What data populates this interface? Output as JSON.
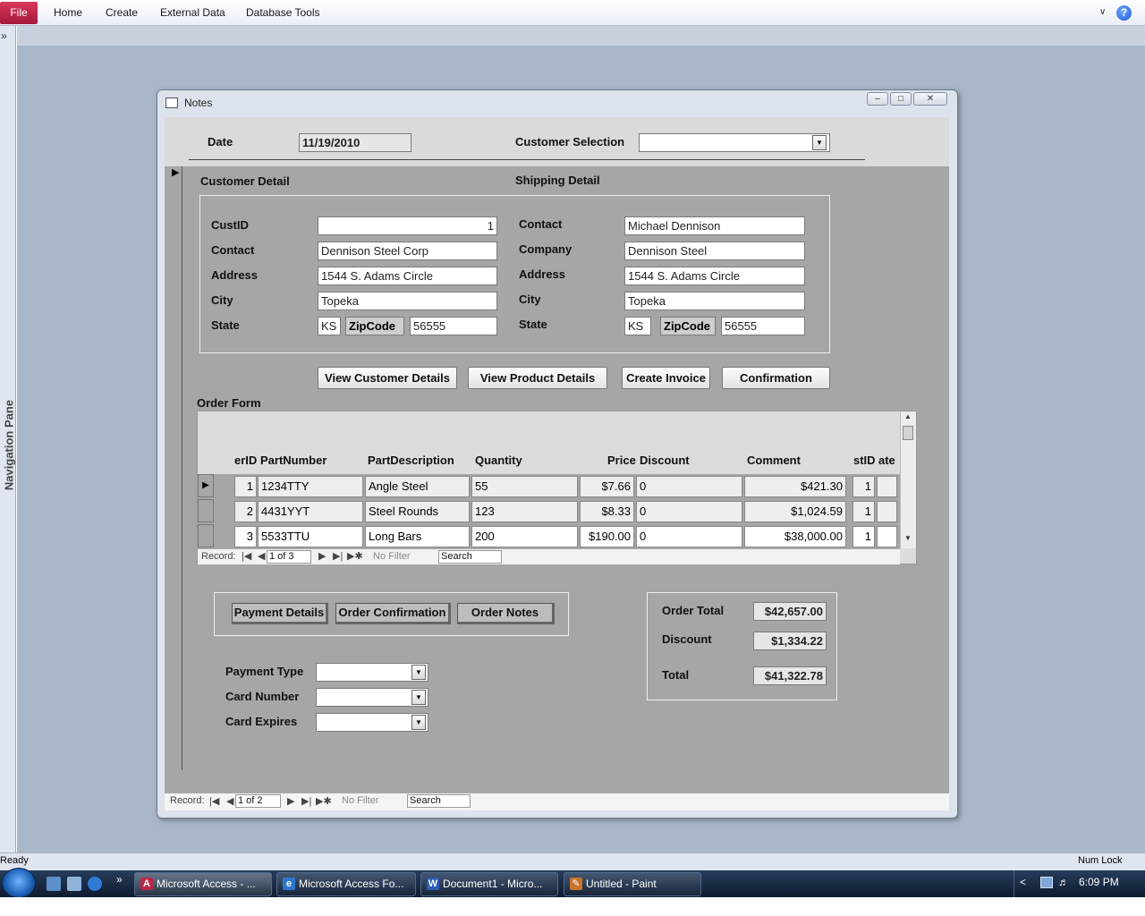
{
  "ribbon": {
    "file": "File",
    "tabs": [
      "Home",
      "Create",
      "External Data",
      "Database Tools"
    ],
    "minimize": "∨",
    "help": "?"
  },
  "nav_pane": {
    "toggle": "»",
    "label": "Navigation Pane"
  },
  "window": {
    "title": "Notes",
    "min": "–",
    "max": "□",
    "close": "✕"
  },
  "header": {
    "date_label": "Date",
    "date_value": "11/19/2010",
    "customer_selection_label": "Customer Selection",
    "customer_selection_value": ""
  },
  "customer": {
    "title": "Customer Detail",
    "custid_label": "CustID",
    "custid": "1",
    "contact_label": "Contact",
    "contact": "Dennison Steel Corp",
    "address_label": "Address",
    "address": "1544 S. Adams Circle",
    "city_label": "City",
    "city": "Topeka",
    "state_label": "State",
    "state": "KS",
    "zip_label": "ZipCode",
    "zip": "56555"
  },
  "shipping": {
    "title": "Shipping Detail",
    "contact_label": "Contact",
    "contact": "Michael Dennison",
    "company_label": "Company",
    "company": "Dennison Steel",
    "address_label": "Address",
    "address": "1544 S. Adams Circle",
    "city_label": "City",
    "city": "Topeka",
    "state_label": "State",
    "state": "KS",
    "zip_label": "ZipCode",
    "zip": "56555"
  },
  "actions": [
    "View Customer Details",
    "View Product Details",
    "Create Invoice",
    "Confirmation"
  ],
  "order_form": {
    "title": "Order Form",
    "columns": [
      "erID",
      "PartNumber",
      "PartDescription",
      "Quantity",
      "Price",
      "Discount",
      "Comment",
      "stID",
      "ate"
    ],
    "rows": [
      {
        "id": "1",
        "part": "1234TTY",
        "desc": "Angle Steel",
        "qty": "55",
        "price": "$7.66",
        "discount": "0",
        "comment": "$421.30",
        "cust": "1",
        "date": ""
      },
      {
        "id": "2",
        "part": "4431YYT",
        "desc": "Steel Rounds",
        "qty": "123",
        "price": "$8.33",
        "discount": "0",
        "comment": "$1,024.59",
        "cust": "1",
        "date": ""
      },
      {
        "id": "3",
        "part": "5533TTU",
        "desc": "Long Bars",
        "qty": "200",
        "price": "$190.00",
        "discount": "0",
        "comment": "$38,000.00",
        "cust": "1",
        "date": ""
      }
    ],
    "nav": {
      "record_label": "Record:",
      "position": "1 of 3",
      "filter": "No Filter",
      "search": "Search"
    }
  },
  "tabs": [
    "Payment Details",
    "Order Confirmation",
    "Order Notes"
  ],
  "payment": {
    "type_label": "Payment Type",
    "card_number_label": "Card Number",
    "card_expires_label": "Card Expires"
  },
  "totals": {
    "order_total_label": "Order Total",
    "order_total": "$42,657.00",
    "discount_label": "Discount",
    "discount": "$1,334.22",
    "total_label": "Total",
    "total": "$41,322.78"
  },
  "form_nav": {
    "record_label": "Record:",
    "position": "1 of 2",
    "filter": "No Filter",
    "search": "Search"
  },
  "status": {
    "left": "Ready",
    "right": "Num Lock"
  },
  "taskbar": {
    "items": [
      {
        "label": "Microsoft Access - ...",
        "icon": "A",
        "color": "#b8274a"
      },
      {
        "label": "Microsoft Access Fo...",
        "icon": "e",
        "color": "#2c78d1"
      },
      {
        "label": "Document1 - Micro...",
        "icon": "W",
        "color": "#2a5bb7"
      },
      {
        "label": "Untitled - Paint",
        "icon": "✎",
        "color": "#c8732a"
      }
    ],
    "more": "»",
    "tray_arrow": "<",
    "time": "6:09 PM"
  }
}
